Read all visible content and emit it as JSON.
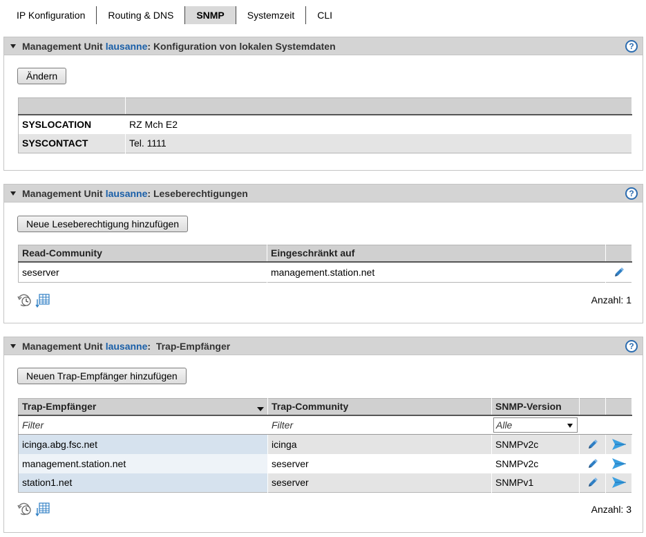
{
  "tabs": [
    {
      "label": "IP Konfiguration",
      "active": false
    },
    {
      "label": "Routing & DNS",
      "active": false
    },
    {
      "label": "SNMP",
      "active": true
    },
    {
      "label": "Systemzeit",
      "active": false
    },
    {
      "label": "CLI",
      "active": false
    }
  ],
  "colors": {
    "accent": "#1a5fa8",
    "header_bg": "#d4d4d4",
    "row_alt": "#e4e4e4",
    "send_icon": "#3a9fe0"
  },
  "panel1": {
    "prefix": "Management Unit",
    "unit": "lausanne",
    "title": ": Konfiguration von lokalen Systemdaten",
    "help": "?",
    "button": "Ändern",
    "rows": [
      {
        "key": "SYSLOCATION",
        "value": "RZ Mch E2"
      },
      {
        "key": "SYSCONTACT",
        "value": "Tel. 1111"
      }
    ]
  },
  "panel2": {
    "prefix": "Management Unit",
    "unit": "lausanne",
    "title": ": Leseberechtigungen",
    "help": "?",
    "button": "Neue Leseberechtigung hinzufügen",
    "columns": [
      "Read-Community",
      "Eingeschränkt auf"
    ],
    "rows": [
      {
        "community": "seserver",
        "restricted": "management.station.net"
      }
    ],
    "count": "Anzahl: 1"
  },
  "panel3": {
    "prefix": "Management Unit",
    "unit": "lausanne",
    "title": ":  Trap-Empfänger",
    "help": "?",
    "button": "Neuen Trap-Empfänger hinzufügen",
    "columns": [
      "Trap-Empfänger",
      "Trap-Community",
      "SNMP-Version"
    ],
    "filter_placeholder": "Filter",
    "version_filter": "Alle",
    "rows": [
      {
        "receiver": "icinga.abg.fsc.net",
        "community": "icinga",
        "version": "SNMPv2c"
      },
      {
        "receiver": "management.station.net",
        "community": "seserver",
        "version": "SNMPv2c"
      },
      {
        "receiver": "station1.net",
        "community": "seserver",
        "version": "SNMPv1"
      }
    ],
    "count": "Anzahl: 3"
  },
  "icons": {
    "help": "help-icon",
    "edit": "edit-pencil-icon",
    "send": "send-arrow-icon",
    "history": "history-clock-icon",
    "table": "table-export-icon"
  }
}
